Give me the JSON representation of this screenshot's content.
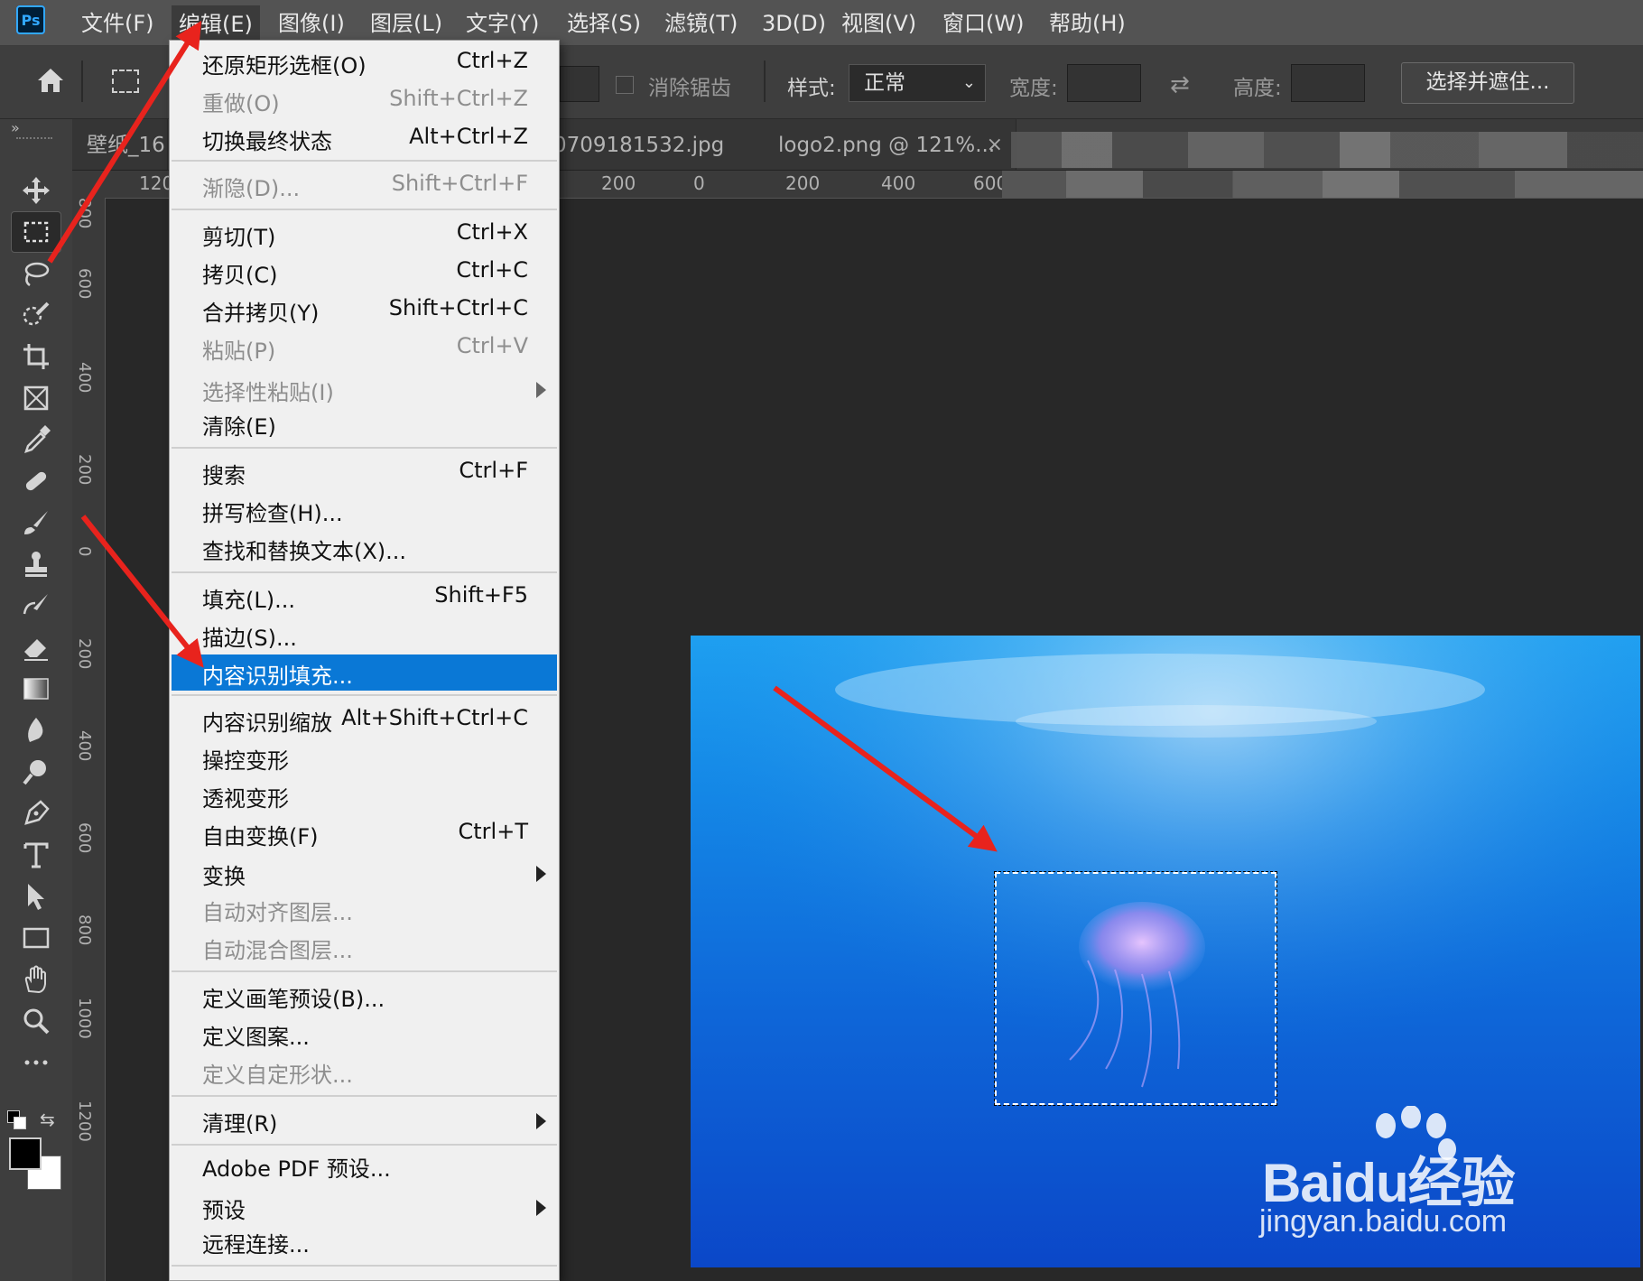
{
  "app": {
    "logo": "Ps"
  },
  "menubar": {
    "items": [
      {
        "label": "文件(F)"
      },
      {
        "label": "编辑(E)"
      },
      {
        "label": "图像(I)"
      },
      {
        "label": "图层(L)"
      },
      {
        "label": "文字(Y)"
      },
      {
        "label": "选择(S)"
      },
      {
        "label": "滤镜(T)"
      },
      {
        "label": "3D(D)"
      },
      {
        "label": "视图(V)"
      },
      {
        "label": "窗口(W)"
      },
      {
        "label": "帮助(H)"
      }
    ]
  },
  "options": {
    "antialias_label": "消除锯齿",
    "style_label": "样式:",
    "style_value": "正常",
    "width_label": "宽度:",
    "height_label": "高度:",
    "select_mask_button": "选择并遮住..."
  },
  "tabs": [
    {
      "label": "壁纸_16"
    },
    {
      "label": "0709181532.jpg"
    },
    {
      "label": "logo2.png @ 121%..."
    }
  ],
  "ruler": {
    "h_ticks": [
      "120",
      "200",
      "0",
      "200",
      "400",
      "600"
    ],
    "v_ticks": [
      "800",
      "600",
      "400",
      "200",
      "0",
      "200",
      "400",
      "600",
      "800",
      "1000",
      "1200"
    ]
  },
  "tools": [
    {
      "icon": "move-icon"
    },
    {
      "icon": "rectangular-marquee-icon"
    },
    {
      "icon": "lasso-icon"
    },
    {
      "icon": "quick-selection-icon"
    },
    {
      "icon": "crop-icon"
    },
    {
      "icon": "frame-icon"
    },
    {
      "icon": "eyedropper-icon"
    },
    {
      "icon": "healing-brush-icon"
    },
    {
      "icon": "brush-icon"
    },
    {
      "icon": "clone-stamp-icon"
    },
    {
      "icon": "history-brush-icon"
    },
    {
      "icon": "eraser-icon"
    },
    {
      "icon": "gradient-icon"
    },
    {
      "icon": "blur-icon"
    },
    {
      "icon": "dodge-icon"
    },
    {
      "icon": "pen-icon"
    },
    {
      "icon": "type-icon"
    },
    {
      "icon": "path-selection-icon"
    },
    {
      "icon": "rectangle-icon"
    },
    {
      "icon": "hand-icon"
    },
    {
      "icon": "zoom-icon"
    },
    {
      "icon": "more-tools-icon"
    }
  ],
  "edit_menu": [
    {
      "label": "还原矩形选框(O)",
      "shortcut": "Ctrl+Z"
    },
    {
      "label": "重做(O)",
      "shortcut": "Shift+Ctrl+Z"
    },
    {
      "label": "切换最终状态",
      "shortcut": "Alt+Ctrl+Z"
    },
    {
      "label": "渐隐(D)...",
      "shortcut": "Shift+Ctrl+F"
    },
    {
      "label": "剪切(T)",
      "shortcut": "Ctrl+X"
    },
    {
      "label": "拷贝(C)",
      "shortcut": "Ctrl+C"
    },
    {
      "label": "合并拷贝(Y)",
      "shortcut": "Shift+Ctrl+C"
    },
    {
      "label": "粘贴(P)",
      "shortcut": "Ctrl+V"
    },
    {
      "label": "选择性粘贴(I)",
      "shortcut": ""
    },
    {
      "label": "清除(E)",
      "shortcut": ""
    },
    {
      "label": "搜索",
      "shortcut": "Ctrl+F"
    },
    {
      "label": "拼写检查(H)...",
      "shortcut": ""
    },
    {
      "label": "查找和替换文本(X)...",
      "shortcut": ""
    },
    {
      "label": "填充(L)...",
      "shortcut": "Shift+F5"
    },
    {
      "label": "描边(S)...",
      "shortcut": ""
    },
    {
      "label": "内容识别填充...",
      "shortcut": ""
    },
    {
      "label": "内容识别缩放",
      "shortcut": "Alt+Shift+Ctrl+C"
    },
    {
      "label": "操控变形",
      "shortcut": ""
    },
    {
      "label": "透视变形",
      "shortcut": ""
    },
    {
      "label": "自由变换(F)",
      "shortcut": "Ctrl+T"
    },
    {
      "label": "变换",
      "shortcut": ""
    },
    {
      "label": "自动对齐图层...",
      "shortcut": ""
    },
    {
      "label": "自动混合图层...",
      "shortcut": ""
    },
    {
      "label": "定义画笔预设(B)...",
      "shortcut": ""
    },
    {
      "label": "定义图案...",
      "shortcut": ""
    },
    {
      "label": "定义自定形状...",
      "shortcut": ""
    },
    {
      "label": "清理(R)",
      "shortcut": ""
    },
    {
      "label": "Adobe PDF 预设...",
      "shortcut": ""
    },
    {
      "label": "预设",
      "shortcut": ""
    },
    {
      "label": "远程连接...",
      "shortcut": ""
    }
  ],
  "watermark": {
    "brand": "Baidu经验",
    "url": "jingyan.baidu.com"
  },
  "colors": {
    "menu_highlight": "#0a78d6",
    "annotation_arrow": "#e8231d"
  }
}
